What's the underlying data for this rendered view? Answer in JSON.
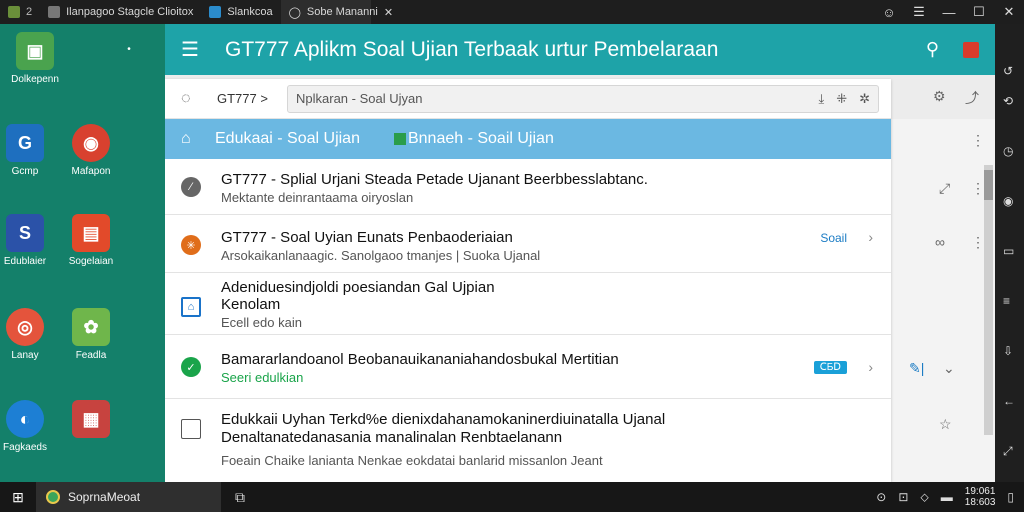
{
  "titlebar": {
    "tabs": [
      {
        "label": "Ilanpagoo Stagcle Clioitox",
        "color": "#6a8f3a"
      },
      {
        "label": "Slankcoa",
        "color": "#2b8ccc"
      },
      {
        "label": "Sobe Mananni",
        "color": "#999999"
      }
    ],
    "close_tab_glyph": "✕",
    "controls": [
      "☺",
      "☰",
      "—",
      "☐",
      "✕"
    ]
  },
  "desktop": {
    "icons": [
      {
        "label": "Dolkepenn",
        "color": "#4aa34e",
        "glyph": "▣"
      },
      {
        "label": "Gcmp",
        "color": "#1e6fbf",
        "glyph": "G"
      },
      {
        "label": "Mafapon",
        "color": "#d8412f",
        "glyph": "◉"
      },
      {
        "label": "Edublaier",
        "color": "#2b52a8",
        "glyph": "S"
      },
      {
        "label": "Sogelaian",
        "color": "#e24a2a",
        "glyph": "▤"
      },
      {
        "label": "Lanay",
        "color": "#e4543c",
        "glyph": "◎"
      },
      {
        "label": "Feadla",
        "color": "#6fb64b",
        "glyph": "✿"
      },
      {
        "label": "Fagkaeds",
        "color": "#1d7fd4",
        "glyph": "◐"
      },
      {
        "label": "",
        "color": "#c7433f",
        "glyph": "▦"
      }
    ]
  },
  "app": {
    "title": "GT777  Aplikm Soal Ujian Terbaak urtur Pembelaraan",
    "search": {
      "crumb": "GT777 >",
      "placeholder": "Nplkaran - Soal Ujyan"
    },
    "selected": {
      "label": "Edukaai - Soal Ujian",
      "sub_label": "Bnnaeh - Soail Ujian"
    },
    "items": [
      {
        "title": "GT777 - Splial Urjani Steada Petade Ujanant Beerbbesslabtanc.",
        "subtitle": "Mektante deinrantaama oiryoslan",
        "lead_color": "#666666",
        "lead_glyph": "⁄"
      },
      {
        "title": "GT777 - Soal Uyian Eunats Penbaoderiaian",
        "subtitle": "Arsokaikanlanaagic. Sanolgaoo tmanjes | Suoka Ujanal",
        "tag": "Soail",
        "lead_color": "#e06d1a",
        "lead_glyph": "✳"
      },
      {
        "title": "Adeniduesindjoldi poesiandan Gal Ujpian",
        "title2": "Kenolam",
        "subtitle": "Ecell edo kain",
        "lead_glyph": "⌂"
      },
      {
        "title": "Bamararlandoanol Beobanauikananiahandosbukal Mertitian",
        "subtitle": "Seeri edulkian",
        "badge": "ⅭƂⅮ",
        "lead_color": "#1aa44a",
        "lead_glyph": "✓"
      },
      {
        "title": "Edukkaii Uyhan Terkd%e dienixdahanamokaninerdiuinatalla Ujanal",
        "title2": "Denaltanatedanasania manalinalan Renbtaelanann",
        "subtitle": "Foeain Chaike lanianta Nenkae eokdatai banlarid missanlon Jeant"
      }
    ]
  },
  "taskbar": {
    "app_label": "SoprnaMeoat",
    "clock_time": "19:061",
    "clock_date": "18:603"
  }
}
